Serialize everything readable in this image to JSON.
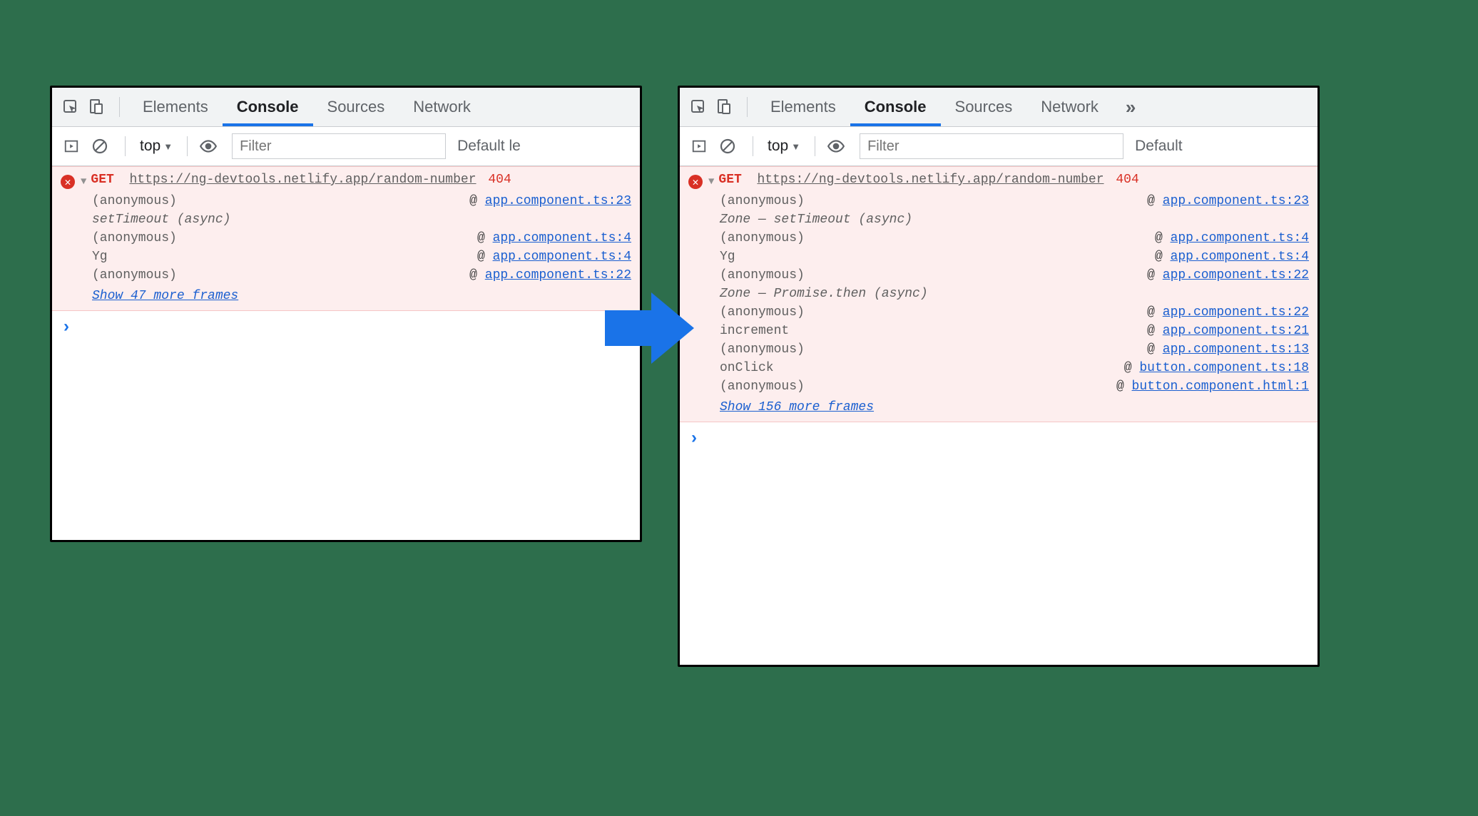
{
  "tabs": {
    "elements": "Elements",
    "console": "Console",
    "sources": "Sources",
    "network": "Network"
  },
  "filterbar": {
    "context": "top",
    "placeholder": "Filter",
    "levels_left": "Default le",
    "levels_right": "Default"
  },
  "left": {
    "method": "GET",
    "url": "https://ng-devtools.netlify.app/random-number",
    "status": "404",
    "rows": [
      {
        "type": "call",
        "fn": "(anonymous)",
        "loc": "app.component.ts:23"
      },
      {
        "type": "async",
        "label": "setTimeout (async)"
      },
      {
        "type": "call",
        "fn": "(anonymous)",
        "loc": "app.component.ts:4"
      },
      {
        "type": "call",
        "fn": "Yg",
        "loc": "app.component.ts:4"
      },
      {
        "type": "call",
        "fn": "(anonymous)",
        "loc": "app.component.ts:22"
      }
    ],
    "show_more": "Show 47 more frames"
  },
  "right": {
    "method": "GET",
    "url": "https://ng-devtools.netlify.app/random-number",
    "status": "404",
    "rows": [
      {
        "type": "call",
        "fn": "(anonymous)",
        "loc": "app.component.ts:23"
      },
      {
        "type": "async",
        "label": "Zone — setTimeout (async)"
      },
      {
        "type": "call",
        "fn": "(anonymous)",
        "loc": "app.component.ts:4"
      },
      {
        "type": "call",
        "fn": "Yg",
        "loc": "app.component.ts:4"
      },
      {
        "type": "call",
        "fn": "(anonymous)",
        "loc": "app.component.ts:22"
      },
      {
        "type": "async",
        "label": "Zone — Promise.then (async)"
      },
      {
        "type": "call",
        "fn": "(anonymous)",
        "loc": "app.component.ts:22"
      },
      {
        "type": "call",
        "fn": "increment",
        "loc": "app.component.ts:21"
      },
      {
        "type": "call",
        "fn": "(anonymous)",
        "loc": "app.component.ts:13"
      },
      {
        "type": "call",
        "fn": "onClick",
        "loc": "button.component.ts:18"
      },
      {
        "type": "call",
        "fn": "(anonymous)",
        "loc": "button.component.html:1"
      }
    ],
    "show_more": "Show 156 more frames"
  }
}
